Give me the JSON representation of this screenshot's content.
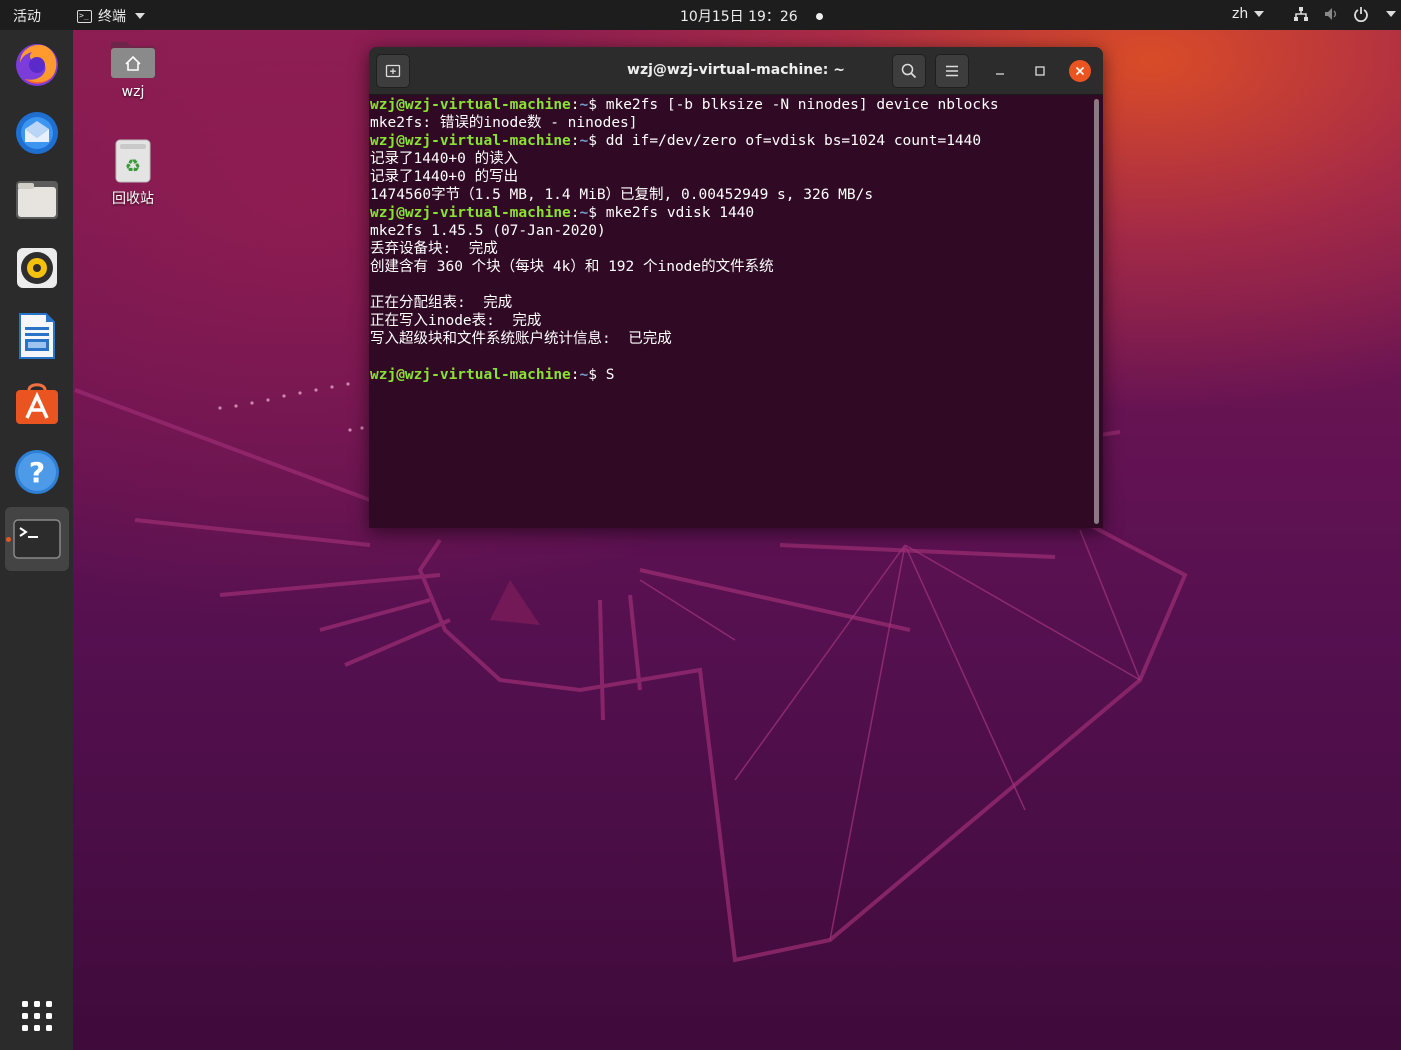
{
  "topbar": {
    "activities": "活动",
    "app_name": "终端",
    "clock": "10月15日  19：26",
    "lang": "zh"
  },
  "dock": {
    "items": [
      {
        "name": "firefox",
        "icon": "firefox-icon"
      },
      {
        "name": "thunderbird",
        "icon": "thunderbird-icon"
      },
      {
        "name": "files",
        "icon": "files-icon"
      },
      {
        "name": "rhythmbox",
        "icon": "rhythmbox-icon"
      },
      {
        "name": "libreoffice-writer",
        "icon": "writer-icon"
      },
      {
        "name": "ubuntu-software",
        "icon": "software-icon"
      },
      {
        "name": "help",
        "icon": "help-icon"
      },
      {
        "name": "terminal",
        "icon": "terminal-icon",
        "active": true
      }
    ],
    "show_apps_icon": "app-grid-icon"
  },
  "desktop": {
    "home_label": "wzj",
    "trash_label": "回收站"
  },
  "terminal": {
    "title": "wzj@wzj-virtual-machine: ~",
    "prompt_user": "wzj@wzj-virtual-machine",
    "prompt_sep": ":",
    "prompt_path": "~",
    "prompt_sym": "$ ",
    "lines": {
      "cmd1": "mke2fs [-b blksize -N ninodes] device nblocks",
      "out1": "mke2fs: 错误的inode数 - ninodes]",
      "cmd2": "dd if=/dev/zero of=vdisk bs=1024 count=1440",
      "out2": "记录了1440+0 的读入",
      "out3": "记录了1440+0 的写出",
      "out4": "1474560字节（1.5 MB, 1.4 MiB）已复制, 0.00452949 s, 326 MB/s",
      "cmd3": "mke2fs vdisk 1440",
      "out5": "mke2fs 1.45.5 (07-Jan-2020)",
      "out6": "丢弃设备块:  完成",
      "out7": "创建含有 360 个块（每块 4k）和 192 个inode的文件系统",
      "out8": "",
      "out9": "正在分配组表:  完成",
      "out10": "正在写入inode表:  完成",
      "out11": "写入超级块和文件系统账户统计信息:  已完成",
      "out12": "",
      "cmd4": "S"
    }
  },
  "colors": {
    "terminal_bg": "#300a24",
    "prompt_green": "#8ae234",
    "path_blue": "#729fcf",
    "ubuntu_orange": "#e95420"
  }
}
